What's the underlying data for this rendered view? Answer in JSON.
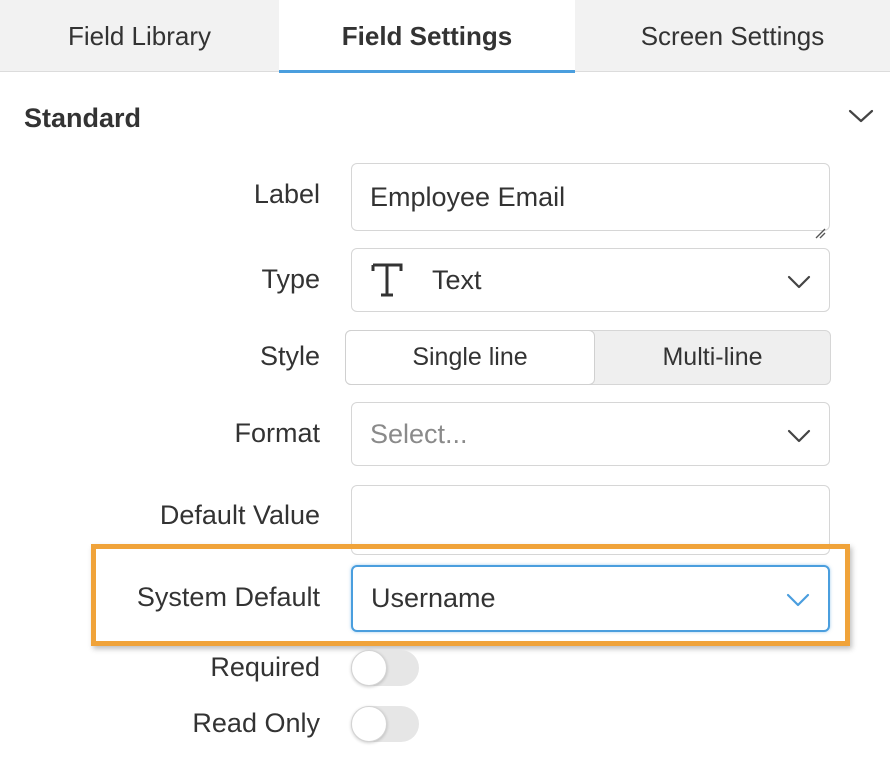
{
  "tabs": [
    {
      "label": "Field Library",
      "active": false
    },
    {
      "label": "Field Settings",
      "active": true
    },
    {
      "label": "Screen Settings",
      "active": false
    }
  ],
  "section": {
    "title": "Standard",
    "icon": "chevron-down-icon"
  },
  "form": {
    "label": {
      "label": "Label",
      "value": "Employee Email"
    },
    "type": {
      "label": "Type",
      "value": "Text",
      "icon": "text-type-icon"
    },
    "style": {
      "label": "Style",
      "options": [
        "Single line",
        "Multi-line"
      ],
      "selected": "Single line"
    },
    "format": {
      "label": "Format",
      "placeholder": "Select..."
    },
    "default_value": {
      "label": "Default Value",
      "value": ""
    },
    "system_default": {
      "label": "System Default",
      "value": "Username"
    },
    "required": {
      "label": "Required",
      "on": false
    },
    "read_only": {
      "label": "Read Only",
      "on": false
    }
  },
  "colors": {
    "highlight": "#f0a33a",
    "accent": "#4a9ede",
    "tab_bar": "#f2f2f2"
  }
}
